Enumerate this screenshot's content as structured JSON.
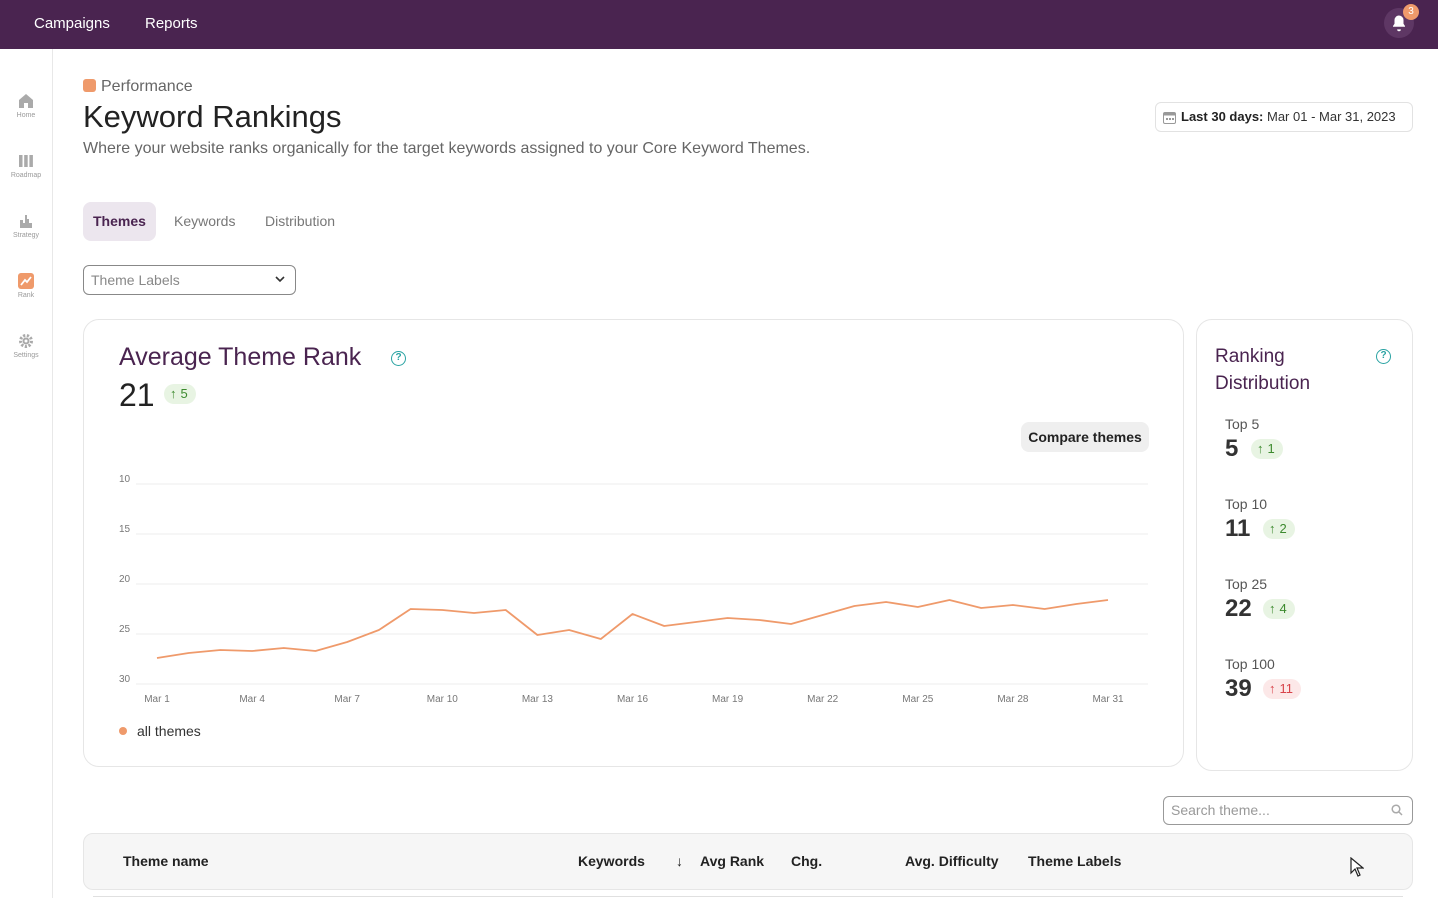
{
  "topbar": {
    "nav": [
      "Campaigns",
      "Reports"
    ],
    "notification_count": "3",
    "bell_icon": "bell-icon",
    "color": "#4a2450"
  },
  "sidebar": {
    "items": [
      {
        "label": "Home",
        "icon": "home-icon"
      },
      {
        "label": "Roadmap",
        "icon": "roadmap-icon"
      },
      {
        "label": "Strategy",
        "icon": "strategy-icon"
      },
      {
        "label": "Rank",
        "icon": "rank-icon",
        "active": true
      },
      {
        "label": "Settings",
        "icon": "gear-icon"
      }
    ]
  },
  "header": {
    "breadcrumb": "Performance",
    "title": "Keyword Rankings",
    "subtitle": "Where your website ranks organically for the target keywords assigned to your Core Keyword Themes.",
    "date_range_label": "Last 30 days:",
    "date_range_value": "Mar 01 - Mar 31, 2023"
  },
  "tabs": [
    {
      "label": "Themes",
      "active": true
    },
    {
      "label": "Keywords"
    },
    {
      "label": "Distribution"
    }
  ],
  "filter": {
    "theme_labels_placeholder": "Theme Labels"
  },
  "avg_rank_card": {
    "title": "Average Theme Rank",
    "value": "21",
    "delta": "5",
    "delta_direction": "up",
    "compare_button": "Compare themes",
    "legend": "all themes"
  },
  "chart_data": {
    "type": "line",
    "title": "Average Theme Rank",
    "x": [
      "Mar 1",
      "Mar 2",
      "Mar 3",
      "Mar 4",
      "Mar 5",
      "Mar 6",
      "Mar 7",
      "Mar 8",
      "Mar 9",
      "Mar 10",
      "Mar 11",
      "Mar 12",
      "Mar 13",
      "Mar 14",
      "Mar 15",
      "Mar 16",
      "Mar 17",
      "Mar 18",
      "Mar 19",
      "Mar 20",
      "Mar 21",
      "Mar 22",
      "Mar 23",
      "Mar 24",
      "Mar 25",
      "Mar 26",
      "Mar 27",
      "Mar 28",
      "Mar 29",
      "Mar 30",
      "Mar 31"
    ],
    "x_tick_labels": [
      "Mar 1",
      "Mar 4",
      "Mar 7",
      "Mar 10",
      "Mar 13",
      "Mar 16",
      "Mar 19",
      "Mar 22",
      "Mar 25",
      "Mar 28",
      "Mar 31"
    ],
    "series": [
      {
        "name": "all themes",
        "color": "#ef9a6b",
        "values": [
          27.4,
          26.9,
          26.6,
          26.7,
          26.4,
          26.7,
          25.8,
          24.6,
          22.5,
          22.6,
          22.9,
          22.6,
          25.1,
          24.6,
          25.5,
          23.0,
          24.2,
          23.8,
          23.4,
          23.6,
          24.0,
          23.1,
          22.2,
          21.8,
          22.3,
          21.6,
          22.4,
          22.1,
          22.5,
          22.0,
          21.6
        ]
      }
    ],
    "yticks": [
      10,
      15,
      20,
      25,
      30
    ],
    "ylim": [
      10,
      30
    ],
    "y_reversed": true,
    "grid": true,
    "legend_position": "bottom-left"
  },
  "distribution": {
    "title": "Ranking Distribution",
    "items": [
      {
        "label": "Top 5",
        "value": "5",
        "delta": "1",
        "direction": "up"
      },
      {
        "label": "Top 10",
        "value": "11",
        "delta": "2",
        "direction": "up"
      },
      {
        "label": "Top 25",
        "value": "22",
        "delta": "4",
        "direction": "up"
      },
      {
        "label": "Top 100",
        "value": "39",
        "delta": "11",
        "direction": "down"
      }
    ]
  },
  "search": {
    "placeholder": "Search theme..."
  },
  "table": {
    "columns": [
      "Theme name",
      "Keywords",
      "Avg Rank",
      "Chg.",
      "Avg. Difficulty",
      "Theme Labels"
    ],
    "sorted_column": "Avg Rank"
  }
}
